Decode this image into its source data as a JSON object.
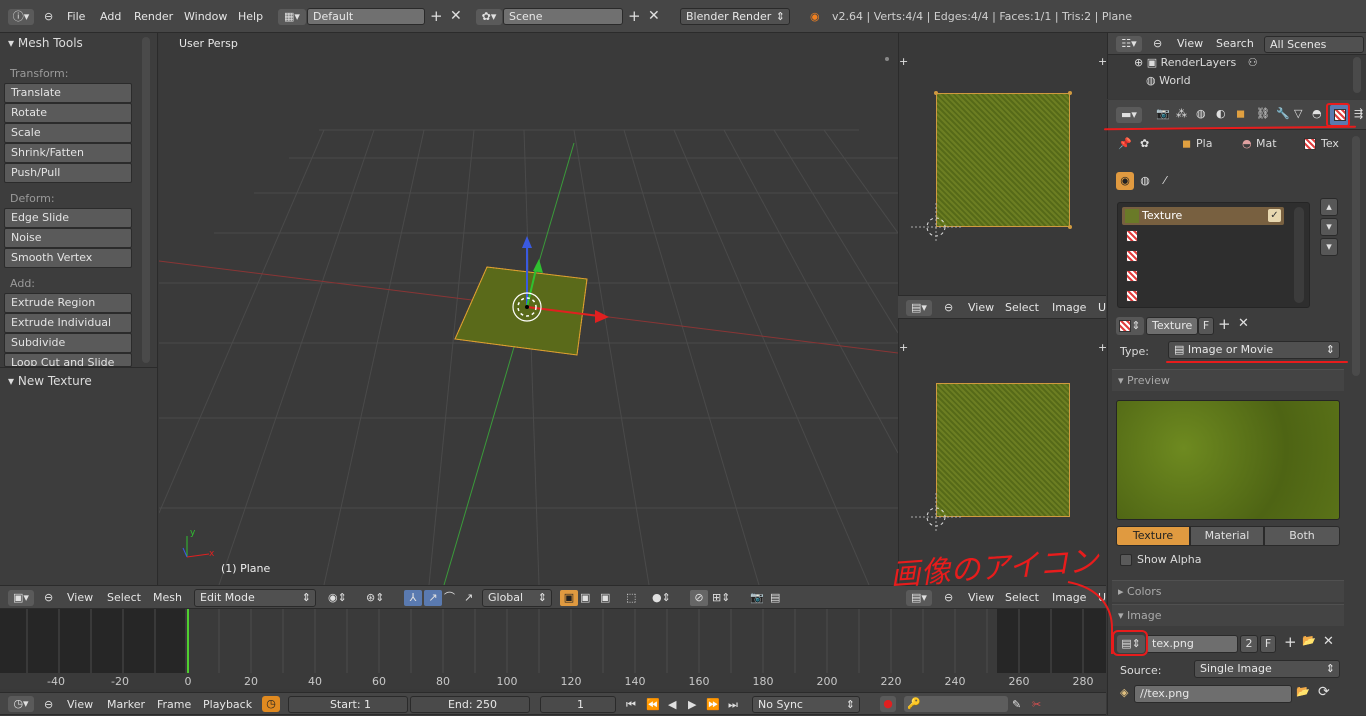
{
  "top_bar": {
    "menu": [
      "File",
      "Add",
      "Render",
      "Window",
      "Help"
    ],
    "layout": "Default",
    "scene": "Scene",
    "engine": "Blender Render",
    "stats": "v2.64 | Verts:4/4 | Edges:4/4 | Faces:1/1 | Tris:2 | Plane"
  },
  "tool_shelf": {
    "title": "Mesh Tools",
    "transform_label": "Transform:",
    "transform": [
      "Translate",
      "Rotate",
      "Scale",
      "Shrink/Fatten",
      "Push/Pull"
    ],
    "deform_label": "Deform:",
    "deform": [
      "Edge Slide",
      "Noise",
      "Smooth Vertex"
    ],
    "add_label": "Add:",
    "add": [
      "Extrude Region",
      "Extrude Individual",
      "Subdivide",
      "Loop Cut and Slide"
    ],
    "new_texture": "New Texture"
  },
  "viewport": {
    "label": "User Persp",
    "object_label": "(1) Plane",
    "axis_x": "x",
    "axis_y": "y"
  },
  "view3d_header": {
    "menu": [
      "View",
      "Select",
      "Mesh"
    ],
    "mode": "Edit Mode",
    "orientation": "Global"
  },
  "uv_header": {
    "menu": [
      "View",
      "Select",
      "Image"
    ]
  },
  "timeline": {
    "ticks": [
      "-40",
      "-20",
      "0",
      "20",
      "40",
      "60",
      "80",
      "100",
      "120",
      "140",
      "160",
      "180",
      "200",
      "220",
      "240",
      "260",
      "280"
    ],
    "menu": [
      "View",
      "Marker",
      "Frame",
      "Playback"
    ],
    "start": "Start: 1",
    "end": "End: 250",
    "current": "1",
    "sync": "No Sync"
  },
  "outliner": {
    "menu": [
      "View",
      "Search"
    ],
    "filter": "All Scenes",
    "items": [
      "RenderLayers",
      "World"
    ]
  },
  "properties": {
    "context": [
      "Pla",
      "Mat",
      "Tex"
    ],
    "slot_name": "Texture",
    "texture_name": "Texture",
    "fake_user": "F",
    "type_label": "Type:",
    "type_value": "Image or Movie",
    "preview_title": "Preview",
    "preview_tabs": [
      "Texture",
      "Material",
      "Both"
    ],
    "show_alpha": "Show Alpha",
    "colors_title": "Colors",
    "image_title": "Image",
    "image_name": "tex.png",
    "image_users": "2",
    "image_fake": "F",
    "source_label": "Source:",
    "source_value": "Single Image",
    "filepath": "//tex.png"
  },
  "annotation": {
    "text": "画像のアイコン",
    "color": "#e81c1c"
  }
}
